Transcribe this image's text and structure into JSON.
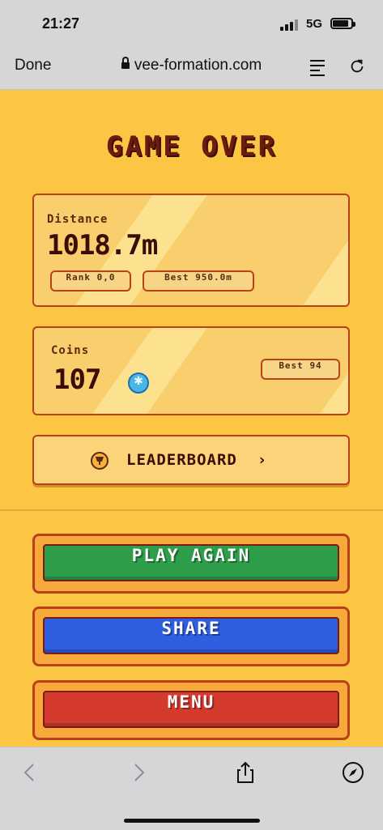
{
  "status": {
    "time": "21:27",
    "network": "5G"
  },
  "browser": {
    "done_label": "Done",
    "url": "vee-formation.com"
  },
  "game": {
    "title": "GAME OVER",
    "distance": {
      "label": "Distance",
      "value": "1018.7m",
      "rank_label": "Rank",
      "rank_value": "0,0",
      "best_label": "Best",
      "best_value": "950.0m"
    },
    "coins": {
      "label": "Coins",
      "value": "107",
      "best_label": "Best",
      "best_value": "94"
    },
    "leaderboard_label": "LEADERBOARD",
    "buttons": {
      "play_again": "PLAY AGAIN",
      "share": "SHARE",
      "menu": "MENU"
    },
    "colors": {
      "background": "#fcc544",
      "play": "#2e9e4a",
      "share": "#2f5fe0",
      "menu": "#d43a2e",
      "title": "#6a1c10"
    }
  }
}
